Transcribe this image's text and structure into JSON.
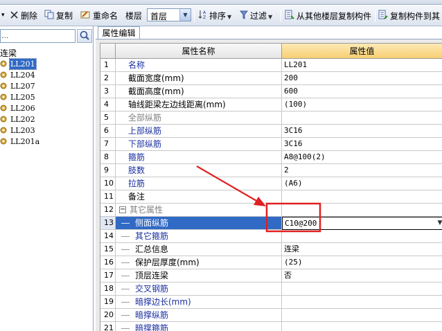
{
  "toolbar": {
    "delete_label": "删除",
    "copy_label": "复制",
    "rename_label": "重命名",
    "floor_label": "楼层",
    "floor_value": "首层",
    "sort_label": "排序",
    "filter_label": "过滤",
    "copy_from_floor_label": "从其他楼层复制构件",
    "copy_to_other_label": "复制构件到其"
  },
  "left_panel": {
    "search_placeholder": "...",
    "root_label": "连梁",
    "items": [
      {
        "label": "LL201",
        "selected": true
      },
      {
        "label": "LL204",
        "selected": false
      },
      {
        "label": "LL207",
        "selected": false
      },
      {
        "label": "LL205",
        "selected": false
      },
      {
        "label": "LL206",
        "selected": false
      },
      {
        "label": "LL202",
        "selected": false
      },
      {
        "label": "LL203",
        "selected": false
      },
      {
        "label": "LL201a",
        "selected": false
      }
    ]
  },
  "property_editor": {
    "tab_label": "属性编辑",
    "column_name": "属性名称",
    "column_value": "属性值",
    "rows": [
      {
        "num": "1",
        "name": "名称",
        "value": "LL201",
        "style": "blue"
      },
      {
        "num": "2",
        "name": "截面宽度(mm)",
        "value": "200",
        "style": "black"
      },
      {
        "num": "3",
        "name": "截面高度(mm)",
        "value": "600",
        "style": "black"
      },
      {
        "num": "4",
        "name": "轴线距梁左边线距离(mm)",
        "value": "(100)",
        "style": "black"
      },
      {
        "num": "5",
        "name": "全部纵筋",
        "value": "",
        "style": "gray"
      },
      {
        "num": "6",
        "name": "上部纵筋",
        "value": "3C16",
        "style": "blue"
      },
      {
        "num": "7",
        "name": "下部纵筋",
        "value": "3C16",
        "style": "blue"
      },
      {
        "num": "8",
        "name": "箍筋",
        "value": "A8@100(2)",
        "style": "blue"
      },
      {
        "num": "9",
        "name": "肢数",
        "value": "2",
        "style": "blue"
      },
      {
        "num": "10",
        "name": "拉筋",
        "value": "(A6)",
        "style": "blue"
      },
      {
        "num": "11",
        "name": "备注",
        "value": "",
        "style": "black"
      },
      {
        "num": "12",
        "name": "其它属性",
        "value": "",
        "style": "gray",
        "group": true
      },
      {
        "num": "13",
        "name": "侧面纵筋",
        "value": "C10@200",
        "style": "blue",
        "child": true,
        "selected": true
      },
      {
        "num": "14",
        "name": "其它箍筋",
        "value": "",
        "style": "blue",
        "child": true
      },
      {
        "num": "15",
        "name": "汇总信息",
        "value": "连梁",
        "style": "black",
        "child": true
      },
      {
        "num": "16",
        "name": "保护层厚度(mm)",
        "value": "(25)",
        "style": "black",
        "child": true
      },
      {
        "num": "17",
        "name": "顶层连梁",
        "value": "否",
        "style": "black",
        "child": true
      },
      {
        "num": "18",
        "name": "交叉钢筋",
        "value": "",
        "style": "blue",
        "child": true
      },
      {
        "num": "19",
        "name": "暗撑边长(mm)",
        "value": "",
        "style": "blue",
        "child": true
      },
      {
        "num": "20",
        "name": "暗撑纵筋",
        "value": "",
        "style": "blue",
        "child": true
      },
      {
        "num": "21",
        "name": "暗撑箍筋",
        "value": "",
        "style": "blue",
        "child": true
      }
    ]
  },
  "colors": {
    "selection": "#316ac5",
    "header_value_bg": "#f8cf72",
    "blue_text": "#1a2fa0",
    "annotation_red": "#e02020"
  },
  "icons": [
    "close-x-icon",
    "copy-icon",
    "rename-icon",
    "sort-icon",
    "filter-icon",
    "copy-from-floor-icon",
    "copy-to-icon",
    "search-icon",
    "gear-icon",
    "expand-collapse-icon",
    "dropdown-arrow-icon"
  ]
}
